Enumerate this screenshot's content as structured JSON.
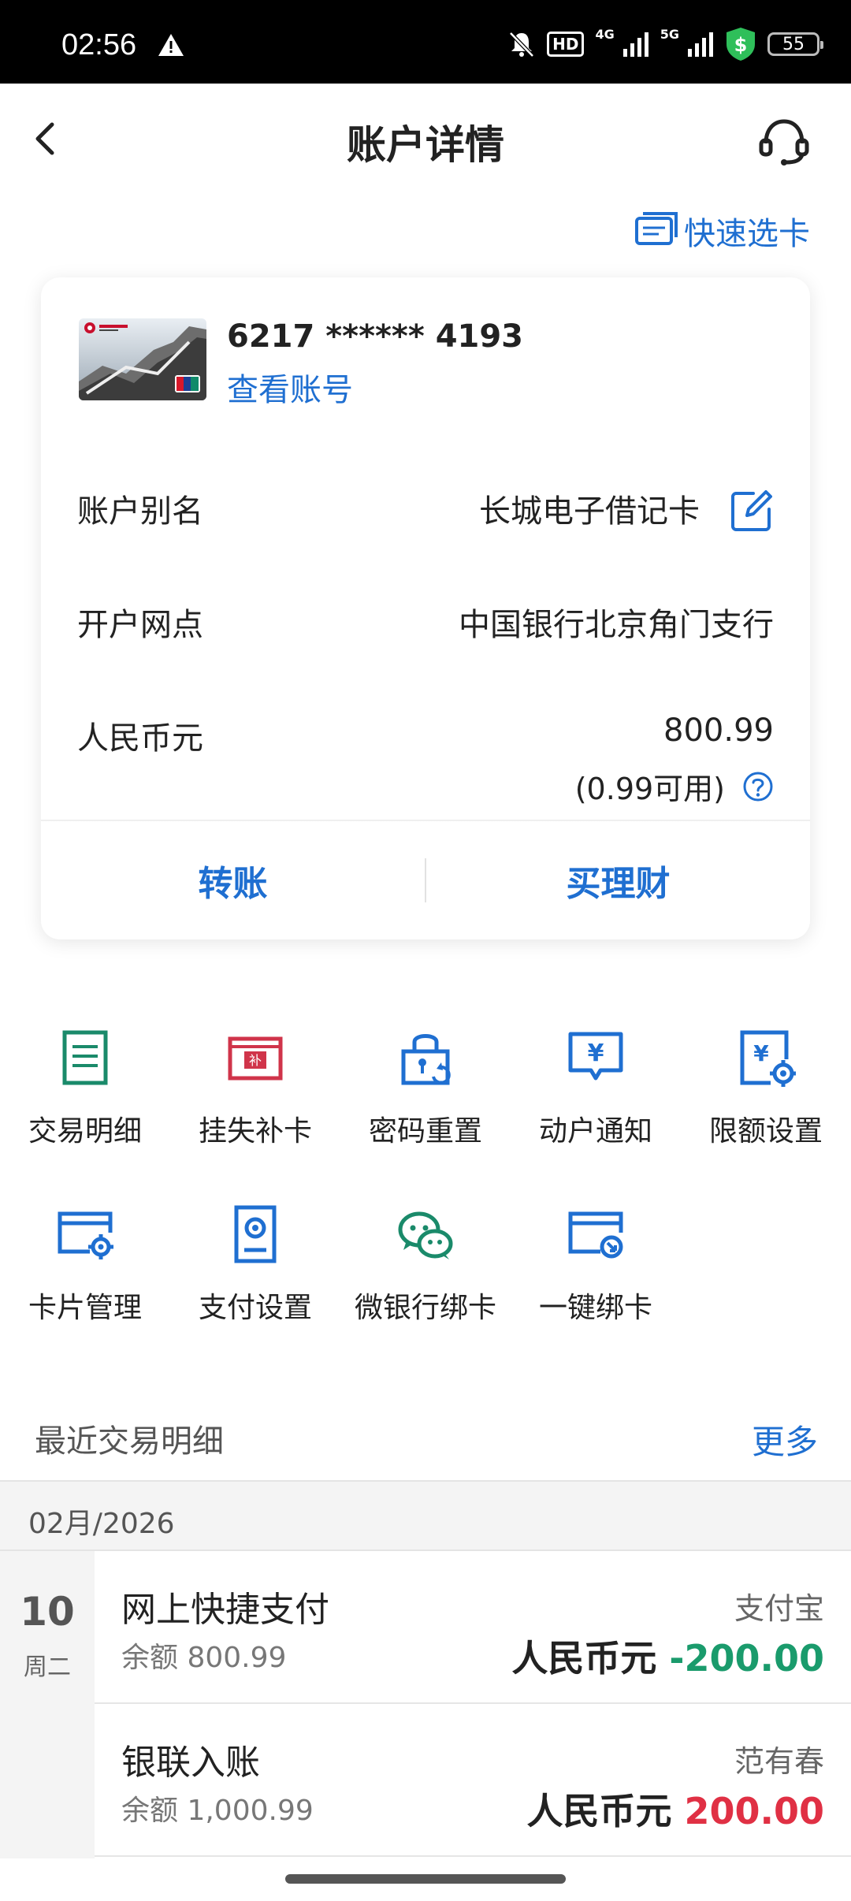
{
  "status_bar": {
    "time": "02:56",
    "battery": "55",
    "net1": "4G",
    "net2": "5G",
    "hd": "HD"
  },
  "header": {
    "title": "账户详情"
  },
  "quick_select": {
    "label": "快速选卡"
  },
  "account": {
    "card_number": "6217 ****** 4193",
    "view_account": "查看账号",
    "alias_label": "账户别名",
    "alias_value": "长城电子借记卡",
    "branch_label": "开户网点",
    "branch_value": "中国银行北京角门支行",
    "currency_label": "人民币元",
    "balance": "800.99",
    "available": "(0.99可用)",
    "actions": {
      "transfer": "转账",
      "buy_wealth": "买理财"
    }
  },
  "grid": [
    {
      "label": "交易明细",
      "icon": "document-list-icon"
    },
    {
      "label": "挂失补卡",
      "icon": "card-replace-icon"
    },
    {
      "label": "密码重置",
      "icon": "lock-reset-icon"
    },
    {
      "label": "动户通知",
      "icon": "yuan-message-icon"
    },
    {
      "label": "限额设置",
      "icon": "yuan-settings-icon"
    },
    {
      "label": "卡片管理",
      "icon": "card-settings-icon"
    },
    {
      "label": "支付设置",
      "icon": "payment-settings-icon"
    },
    {
      "label": "微银行绑卡",
      "icon": "wechat-icon"
    },
    {
      "label": "一键绑卡",
      "icon": "card-bind-icon"
    }
  ],
  "recent": {
    "title": "最近交易明细",
    "more": "更多",
    "month": "02月/2026",
    "day": "10",
    "weekday": "周二",
    "transactions": [
      {
        "name": "网上快捷支付",
        "balance": "余额 800.99",
        "party": "支付宝",
        "currency": "人民币元",
        "amount": "-200.00",
        "direction": "out"
      },
      {
        "name": "银联入账",
        "balance": "余额 1,000.99",
        "party": "范有春",
        "currency": "人民币元",
        "amount": "200.00",
        "direction": "in"
      }
    ]
  },
  "colors": {
    "accent_blue": "#1f6fd1",
    "green_icon": "#1a8a6a",
    "red_icon": "#d0344a",
    "negative": "#1a9b6c",
    "positive": "#e03044"
  }
}
